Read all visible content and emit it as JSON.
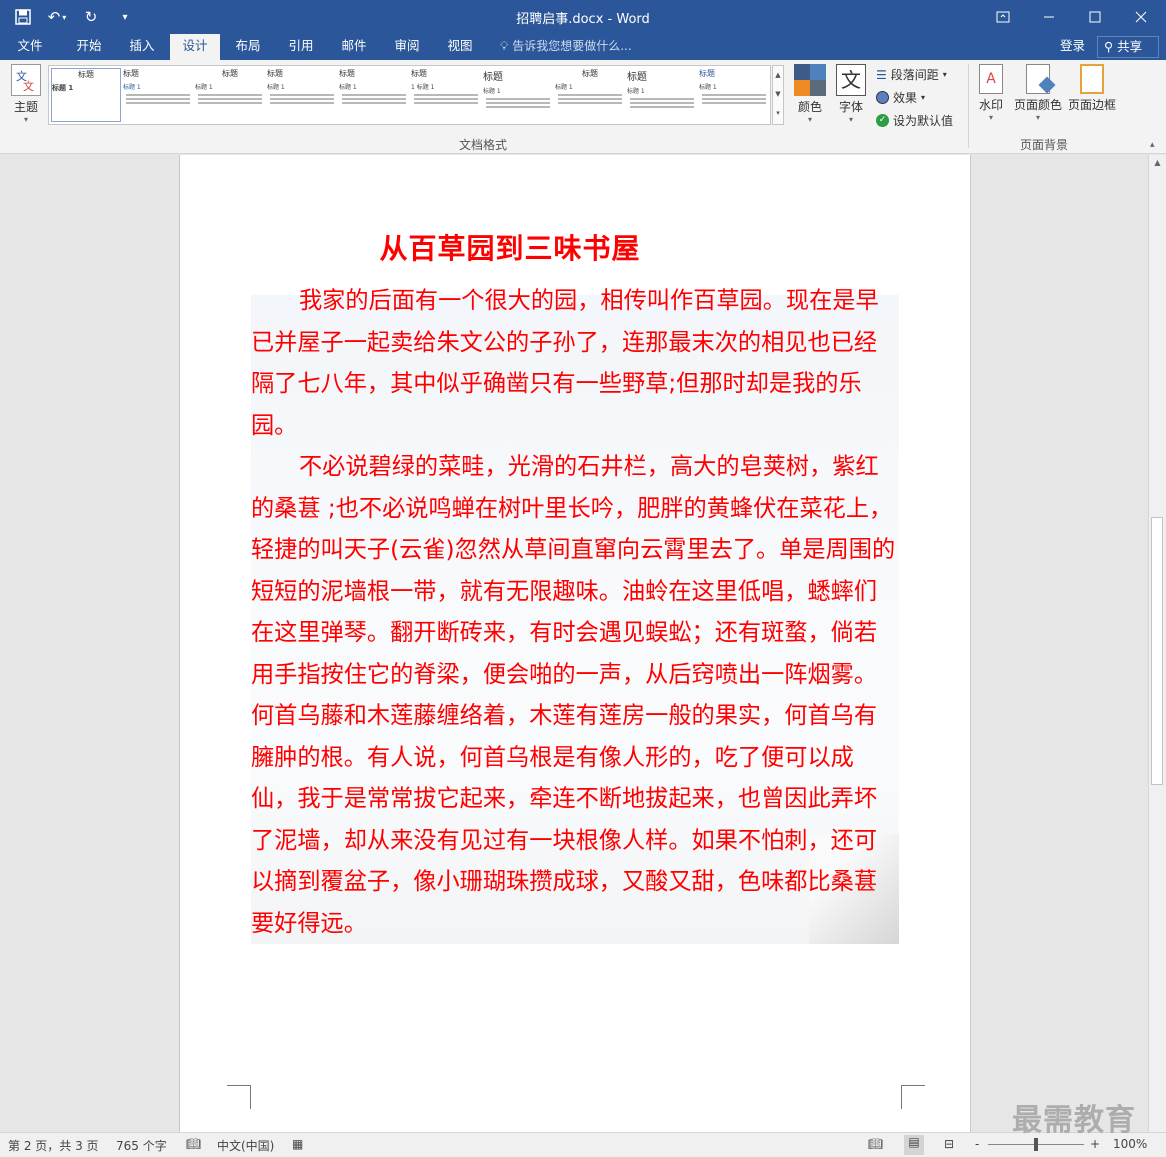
{
  "window": {
    "title": "招聘启事.docx - Word",
    "controls": [
      "ribbon-display",
      "minimize",
      "maximize",
      "close"
    ]
  },
  "tabs": [
    {
      "label": "文件",
      "active": false
    },
    {
      "label": "开始",
      "active": false
    },
    {
      "label": "插入",
      "active": false
    },
    {
      "label": "设计",
      "active": true
    },
    {
      "label": "布局",
      "active": false
    },
    {
      "label": "引用",
      "active": false
    },
    {
      "label": "邮件",
      "active": false
    },
    {
      "label": "审阅",
      "active": false
    },
    {
      "label": "视图",
      "active": false
    }
  ],
  "tell_me": "告诉我您想要做什么...",
  "account": {
    "login": "登录",
    "share": "共享"
  },
  "ribbon": {
    "theme_label": "主题",
    "gallery_items": [
      {
        "heading": "标题",
        "sub": "标题 1"
      },
      {
        "heading": "标题",
        "sub": "标题 1"
      },
      {
        "heading": "标题",
        "sub": "标题 1"
      },
      {
        "heading": "标题",
        "sub": "标题 1"
      },
      {
        "heading": "标题",
        "sub": "标题 1"
      },
      {
        "heading": "标题",
        "sub": "1 标题 1"
      },
      {
        "heading": "标题",
        "sub": "标题 1"
      },
      {
        "heading": "标题",
        "sub": "标题 1"
      },
      {
        "heading": "标题",
        "sub": "标题 1"
      },
      {
        "heading": "标题",
        "sub": "标题 1"
      }
    ],
    "colors_label": "颜色",
    "fonts_label": "字体",
    "paragraph_spacing": "段落间距",
    "effects": "效果",
    "set_default": "设为默认值",
    "doc_format_group": "文档格式",
    "watermark": "水印",
    "page_color": "页面颜色",
    "page_borders": "页面边框",
    "page_bg_group": "页面背景"
  },
  "document": {
    "heading": "从百草园到三味书屋",
    "paragraphs": [
      "我家的后面有一个很大的园，相传叫作百草园。现在是早已并屋子一起卖给朱文公的子孙了，连那最末次的相见也已经隔了七八年，其中似乎确凿只有一些野草;但那时却是我的乐园。",
      "不必说碧绿的菜畦，光滑的石井栏，高大的皂荚树，紫红的桑葚 ;也不必说鸣蝉在树叶里长吟，肥胖的黄蜂伏在菜花上，轻捷的叫天子(云雀)忽然从草间直窜向云霄里去了。单是周围的短短的泥墙根一带，就有无限趣味。油蛉在这里低唱，蟋蟀们在这里弹琴。翻开断砖来，有时会遇见蜈蚣；还有斑蝥，倘若用手指按住它的脊梁，便会啪的一声，从后窍喷出一阵烟雾。何首乌藤和木莲藤缠络着，木莲有莲房一般的果实，何首乌有臃肿的根。有人说，何首乌根是有像人形的，吃了便可以成仙，我于是常常拔它起来，牵连不断地拔起来，也曾因此弄坏了泥墙，却从来没有见过有一块根像人样。如果不怕刺，还可以摘到覆盆子，像小珊瑚珠攒成球，又酸又甜，色味都比桑葚要好得远。"
    ],
    "text_color": "#ff0000"
  },
  "status": {
    "page": "第 2 页，共 3 页",
    "words": "765 个字",
    "language": "中文(中国)",
    "zoom": "100%",
    "zoom_minus": "-",
    "zoom_plus": "+"
  },
  "watermark_logo": "最需教育",
  "colors": {
    "accent": "#2b579a",
    "ribbon_bg": "#f3f3f3"
  }
}
